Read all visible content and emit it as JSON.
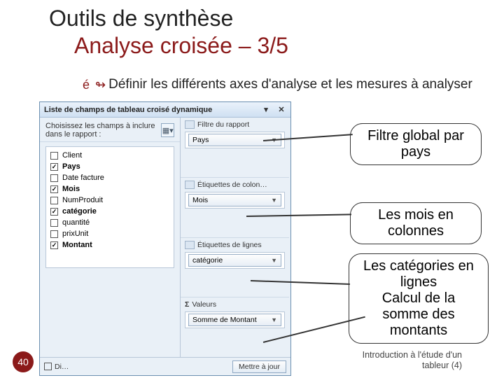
{
  "title": {
    "line1": "Outils de synthèse",
    "line2": "Analyse croisée – 3/5"
  },
  "bullet": "Définir les différents axes d'analyse et les mesures à analyser",
  "panel": {
    "header": "Liste de champs de tableau croisé dynamique",
    "instruction": "Choisissez les champs à inclure dans le rapport :",
    "fields": [
      {
        "label": "Client",
        "checked": false,
        "bold": false
      },
      {
        "label": "Pays",
        "checked": true,
        "bold": true
      },
      {
        "label": "Date facture",
        "checked": false,
        "bold": false
      },
      {
        "label": "Mois",
        "checked": true,
        "bold": true
      },
      {
        "label": "NumProduit",
        "checked": false,
        "bold": false
      },
      {
        "label": "catégorie",
        "checked": true,
        "bold": true
      },
      {
        "label": "quantité",
        "checked": false,
        "bold": false
      },
      {
        "label": "prixUnit",
        "checked": false,
        "bold": false
      },
      {
        "label": "Montant",
        "checked": true,
        "bold": true
      }
    ],
    "zones": {
      "filter": {
        "title": "Filtre du rapport",
        "chip": "Pays"
      },
      "cols": {
        "title": "Étiquettes de colon…",
        "chip": "Mois"
      },
      "rows": {
        "title": "Étiquettes de lignes",
        "chip": "catégorie"
      },
      "vals": {
        "title": "Valeurs",
        "chip": "Somme de Montant"
      }
    },
    "footer": {
      "defer": "Di…",
      "update": "Mettre à jour"
    }
  },
  "callouts": {
    "c1": "Filtre global par pays",
    "c2": "Les mois en colonnes",
    "c3": "Les catégories en lignes\nCalcul de la somme des montants"
  },
  "page_number": "40",
  "footer_note": "Introduction à l'étude d'un\ntableur (4)"
}
